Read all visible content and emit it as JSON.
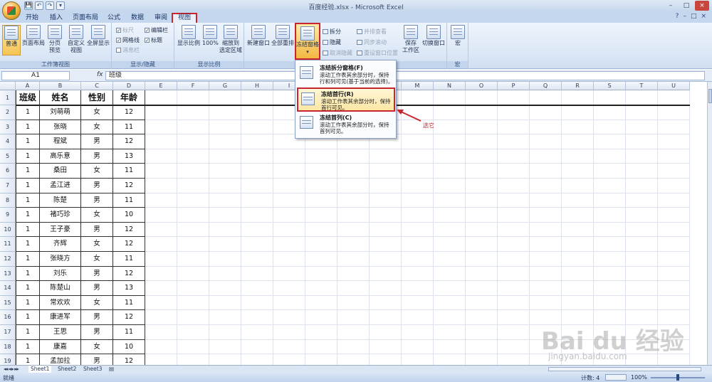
{
  "window": {
    "title": "百度经验.xlsx - Microsoft Excel",
    "controls": [
      "–",
      "□",
      "×"
    ]
  },
  "qat": [
    "💾",
    "↶",
    "↷",
    "▾"
  ],
  "tabs": [
    {
      "label": "开始",
      "active": false
    },
    {
      "label": "插入",
      "active": false
    },
    {
      "label": "页面布局",
      "active": false
    },
    {
      "label": "公式",
      "active": false
    },
    {
      "label": "数据",
      "active": false
    },
    {
      "label": "审阅",
      "active": false
    },
    {
      "label": "视图",
      "active": true
    }
  ],
  "help_icons": [
    "?",
    "–",
    "□",
    "×"
  ],
  "ribbon": {
    "workbook_views": {
      "label": "工作簿视图",
      "buttons": [
        "普通",
        "页面布局",
        "分页\n预览",
        "自定义\n视图",
        "全屏显示"
      ]
    },
    "show_hide": {
      "label": "显示/隐藏",
      "checks": [
        {
          "label": "标尺",
          "checked": true,
          "disabled": true
        },
        {
          "label": "网格线",
          "checked": true,
          "disabled": false
        },
        {
          "label": "消息栏",
          "checked": false,
          "disabled": true
        },
        {
          "label": "编辑栏",
          "checked": true,
          "disabled": false
        },
        {
          "label": "标题",
          "checked": true,
          "disabled": false
        }
      ]
    },
    "zoom": {
      "label": "显示比例",
      "buttons": [
        "显示比例",
        "100%",
        "缩放到\n选定区域"
      ]
    },
    "window": {
      "label": "窗口",
      "buttons": [
        "新建窗口",
        "全部重排",
        "冻结窗格"
      ],
      "small": [
        {
          "label": "拆分",
          "disabled": false
        },
        {
          "label": "隐藏",
          "disabled": false
        },
        {
          "label": "取消隐藏",
          "disabled": true
        },
        {
          "label": "并排查看",
          "disabled": true
        },
        {
          "label": "同步滚动",
          "disabled": true
        },
        {
          "label": "重设窗口位置",
          "disabled": true
        }
      ],
      "save_workspace": "保存\n工作区",
      "switch_windows": "切换窗口"
    },
    "macros": {
      "label": "宏",
      "button": "宏"
    }
  },
  "formula_bar": {
    "name_box": "A1",
    "fx": "fx",
    "value": "班级"
  },
  "columns": [
    "A",
    "B",
    "C",
    "D",
    "E",
    "F",
    "G",
    "H",
    "I",
    "J",
    "K",
    "L",
    "M",
    "N",
    "O",
    "P",
    "Q",
    "R",
    "S",
    "T",
    "U"
  ],
  "table": {
    "headers": [
      "班级",
      "姓名",
      "性别",
      "年龄"
    ],
    "rows": [
      [
        "1",
        "刘萌萌",
        "女",
        "12"
      ],
      [
        "1",
        "张晓",
        "女",
        "11"
      ],
      [
        "1",
        "程斌",
        "男",
        "12"
      ],
      [
        "1",
        "高乐意",
        "男",
        "13"
      ],
      [
        "1",
        "桑田",
        "女",
        "11"
      ],
      [
        "1",
        "孟江进",
        "男",
        "12"
      ],
      [
        "1",
        "陈楚",
        "男",
        "11"
      ],
      [
        "1",
        "褚巧珍",
        "女",
        "10"
      ],
      [
        "1",
        "王子豪",
        "男",
        "12"
      ],
      [
        "1",
        "齐辉",
        "女",
        "12"
      ],
      [
        "1",
        "张晓方",
        "女",
        "11"
      ],
      [
        "1",
        "刘乐",
        "男",
        "12"
      ],
      [
        "1",
        "陈楚山",
        "男",
        "13"
      ],
      [
        "1",
        "常欢欢",
        "女",
        "11"
      ],
      [
        "1",
        "康进军",
        "男",
        "12"
      ],
      [
        "1",
        "王思",
        "男",
        "11"
      ],
      [
        "1",
        "康嘉",
        "女",
        "10"
      ],
      [
        "1",
        "孟加拉",
        "男",
        "12"
      ]
    ]
  },
  "row_numbers": [
    "1",
    "2",
    "3",
    "4",
    "5",
    "6",
    "7",
    "8",
    "9",
    "10",
    "11",
    "12",
    "13",
    "14",
    "15",
    "16",
    "17",
    "18",
    "19"
  ],
  "freeze_menu": [
    {
      "title": "冻结拆分窗格(F)",
      "desc": "滚动工作表其余部分时，保持行和列可见(基于当前的选择)。",
      "highlight": false
    },
    {
      "title": "冻结首行(R)",
      "desc": "滚动工作表其余部分时，保持首行可见。",
      "highlight": true
    },
    {
      "title": "冻结首列(C)",
      "desc": "滚动工作表其余部分时，保持首列可见。",
      "highlight": false
    }
  ],
  "annotation": "选它",
  "sheets": [
    {
      "name": "Sheet1",
      "active": true
    },
    {
      "name": "Sheet2",
      "active": false
    },
    {
      "name": "Sheet3",
      "active": false
    }
  ],
  "sheet_nav": "◂◂ ◂ ▸ ▸▸",
  "status": {
    "left": "就绪",
    "count": "计数: 4",
    "zoom": "100%"
  },
  "watermark": {
    "brand": "Bai du 经验",
    "url": "jingyan.baidu.com"
  }
}
